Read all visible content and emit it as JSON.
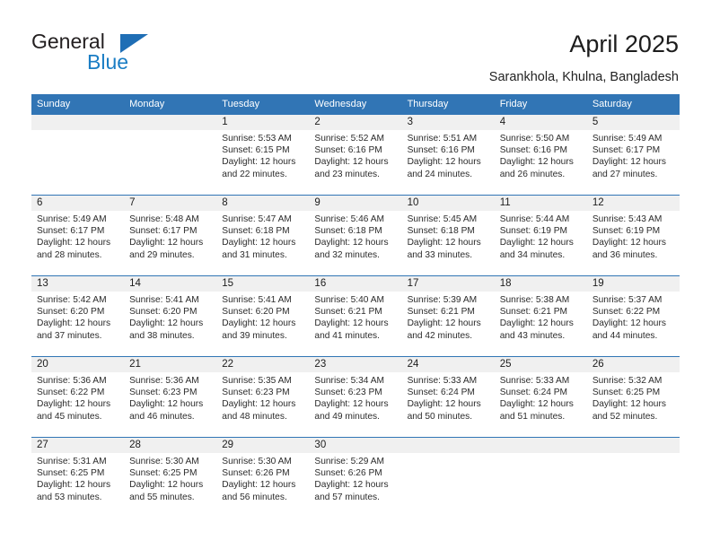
{
  "brand": {
    "name_line1": "General",
    "name_line2": "Blue",
    "accent_color": "#1a7dc4",
    "triangle_color": "#1f6eb5"
  },
  "header": {
    "title": "April 2025",
    "subtitle": "Sarankhola, Khulna, Bangladesh"
  },
  "theme": {
    "header_blue": "#3175b5",
    "daynum_band": "#f0f0f0",
    "text": "#2b2b2b"
  },
  "weekday_headers": [
    "Sunday",
    "Monday",
    "Tuesday",
    "Wednesday",
    "Thursday",
    "Friday",
    "Saturday"
  ],
  "weeks": [
    [
      {
        "day": "",
        "sunrise": "",
        "sunset": "",
        "daylight_line1": "",
        "daylight_line2": ""
      },
      {
        "day": "",
        "sunrise": "",
        "sunset": "",
        "daylight_line1": "",
        "daylight_line2": ""
      },
      {
        "day": "1",
        "sunrise": "Sunrise: 5:53 AM",
        "sunset": "Sunset: 6:15 PM",
        "daylight_line1": "Daylight: 12 hours",
        "daylight_line2": "and 22 minutes."
      },
      {
        "day": "2",
        "sunrise": "Sunrise: 5:52 AM",
        "sunset": "Sunset: 6:16 PM",
        "daylight_line1": "Daylight: 12 hours",
        "daylight_line2": "and 23 minutes."
      },
      {
        "day": "3",
        "sunrise": "Sunrise: 5:51 AM",
        "sunset": "Sunset: 6:16 PM",
        "daylight_line1": "Daylight: 12 hours",
        "daylight_line2": "and 24 minutes."
      },
      {
        "day": "4",
        "sunrise": "Sunrise: 5:50 AM",
        "sunset": "Sunset: 6:16 PM",
        "daylight_line1": "Daylight: 12 hours",
        "daylight_line2": "and 26 minutes."
      },
      {
        "day": "5",
        "sunrise": "Sunrise: 5:49 AM",
        "sunset": "Sunset: 6:17 PM",
        "daylight_line1": "Daylight: 12 hours",
        "daylight_line2": "and 27 minutes."
      }
    ],
    [
      {
        "day": "6",
        "sunrise": "Sunrise: 5:49 AM",
        "sunset": "Sunset: 6:17 PM",
        "daylight_line1": "Daylight: 12 hours",
        "daylight_line2": "and 28 minutes."
      },
      {
        "day": "7",
        "sunrise": "Sunrise: 5:48 AM",
        "sunset": "Sunset: 6:17 PM",
        "daylight_line1": "Daylight: 12 hours",
        "daylight_line2": "and 29 minutes."
      },
      {
        "day": "8",
        "sunrise": "Sunrise: 5:47 AM",
        "sunset": "Sunset: 6:18 PM",
        "daylight_line1": "Daylight: 12 hours",
        "daylight_line2": "and 31 minutes."
      },
      {
        "day": "9",
        "sunrise": "Sunrise: 5:46 AM",
        "sunset": "Sunset: 6:18 PM",
        "daylight_line1": "Daylight: 12 hours",
        "daylight_line2": "and 32 minutes."
      },
      {
        "day": "10",
        "sunrise": "Sunrise: 5:45 AM",
        "sunset": "Sunset: 6:18 PM",
        "daylight_line1": "Daylight: 12 hours",
        "daylight_line2": "and 33 minutes."
      },
      {
        "day": "11",
        "sunrise": "Sunrise: 5:44 AM",
        "sunset": "Sunset: 6:19 PM",
        "daylight_line1": "Daylight: 12 hours",
        "daylight_line2": "and 34 minutes."
      },
      {
        "day": "12",
        "sunrise": "Sunrise: 5:43 AM",
        "sunset": "Sunset: 6:19 PM",
        "daylight_line1": "Daylight: 12 hours",
        "daylight_line2": "and 36 minutes."
      }
    ],
    [
      {
        "day": "13",
        "sunrise": "Sunrise: 5:42 AM",
        "sunset": "Sunset: 6:20 PM",
        "daylight_line1": "Daylight: 12 hours",
        "daylight_line2": "and 37 minutes."
      },
      {
        "day": "14",
        "sunrise": "Sunrise: 5:41 AM",
        "sunset": "Sunset: 6:20 PM",
        "daylight_line1": "Daylight: 12 hours",
        "daylight_line2": "and 38 minutes."
      },
      {
        "day": "15",
        "sunrise": "Sunrise: 5:41 AM",
        "sunset": "Sunset: 6:20 PM",
        "daylight_line1": "Daylight: 12 hours",
        "daylight_line2": "and 39 minutes."
      },
      {
        "day": "16",
        "sunrise": "Sunrise: 5:40 AM",
        "sunset": "Sunset: 6:21 PM",
        "daylight_line1": "Daylight: 12 hours",
        "daylight_line2": "and 41 minutes."
      },
      {
        "day": "17",
        "sunrise": "Sunrise: 5:39 AM",
        "sunset": "Sunset: 6:21 PM",
        "daylight_line1": "Daylight: 12 hours",
        "daylight_line2": "and 42 minutes."
      },
      {
        "day": "18",
        "sunrise": "Sunrise: 5:38 AM",
        "sunset": "Sunset: 6:21 PM",
        "daylight_line1": "Daylight: 12 hours",
        "daylight_line2": "and 43 minutes."
      },
      {
        "day": "19",
        "sunrise": "Sunrise: 5:37 AM",
        "sunset": "Sunset: 6:22 PM",
        "daylight_line1": "Daylight: 12 hours",
        "daylight_line2": "and 44 minutes."
      }
    ],
    [
      {
        "day": "20",
        "sunrise": "Sunrise: 5:36 AM",
        "sunset": "Sunset: 6:22 PM",
        "daylight_line1": "Daylight: 12 hours",
        "daylight_line2": "and 45 minutes."
      },
      {
        "day": "21",
        "sunrise": "Sunrise: 5:36 AM",
        "sunset": "Sunset: 6:23 PM",
        "daylight_line1": "Daylight: 12 hours",
        "daylight_line2": "and 46 minutes."
      },
      {
        "day": "22",
        "sunrise": "Sunrise: 5:35 AM",
        "sunset": "Sunset: 6:23 PM",
        "daylight_line1": "Daylight: 12 hours",
        "daylight_line2": "and 48 minutes."
      },
      {
        "day": "23",
        "sunrise": "Sunrise: 5:34 AM",
        "sunset": "Sunset: 6:23 PM",
        "daylight_line1": "Daylight: 12 hours",
        "daylight_line2": "and 49 minutes."
      },
      {
        "day": "24",
        "sunrise": "Sunrise: 5:33 AM",
        "sunset": "Sunset: 6:24 PM",
        "daylight_line1": "Daylight: 12 hours",
        "daylight_line2": "and 50 minutes."
      },
      {
        "day": "25",
        "sunrise": "Sunrise: 5:33 AM",
        "sunset": "Sunset: 6:24 PM",
        "daylight_line1": "Daylight: 12 hours",
        "daylight_line2": "and 51 minutes."
      },
      {
        "day": "26",
        "sunrise": "Sunrise: 5:32 AM",
        "sunset": "Sunset: 6:25 PM",
        "daylight_line1": "Daylight: 12 hours",
        "daylight_line2": "and 52 minutes."
      }
    ],
    [
      {
        "day": "27",
        "sunrise": "Sunrise: 5:31 AM",
        "sunset": "Sunset: 6:25 PM",
        "daylight_line1": "Daylight: 12 hours",
        "daylight_line2": "and 53 minutes."
      },
      {
        "day": "28",
        "sunrise": "Sunrise: 5:30 AM",
        "sunset": "Sunset: 6:25 PM",
        "daylight_line1": "Daylight: 12 hours",
        "daylight_line2": "and 55 minutes."
      },
      {
        "day": "29",
        "sunrise": "Sunrise: 5:30 AM",
        "sunset": "Sunset: 6:26 PM",
        "daylight_line1": "Daylight: 12 hours",
        "daylight_line2": "and 56 minutes."
      },
      {
        "day": "30",
        "sunrise": "Sunrise: 5:29 AM",
        "sunset": "Sunset: 6:26 PM",
        "daylight_line1": "Daylight: 12 hours",
        "daylight_line2": "and 57 minutes."
      },
      {
        "day": "",
        "sunrise": "",
        "sunset": "",
        "daylight_line1": "",
        "daylight_line2": ""
      },
      {
        "day": "",
        "sunrise": "",
        "sunset": "",
        "daylight_line1": "",
        "daylight_line2": ""
      },
      {
        "day": "",
        "sunrise": "",
        "sunset": "",
        "daylight_line1": "",
        "daylight_line2": ""
      }
    ]
  ]
}
